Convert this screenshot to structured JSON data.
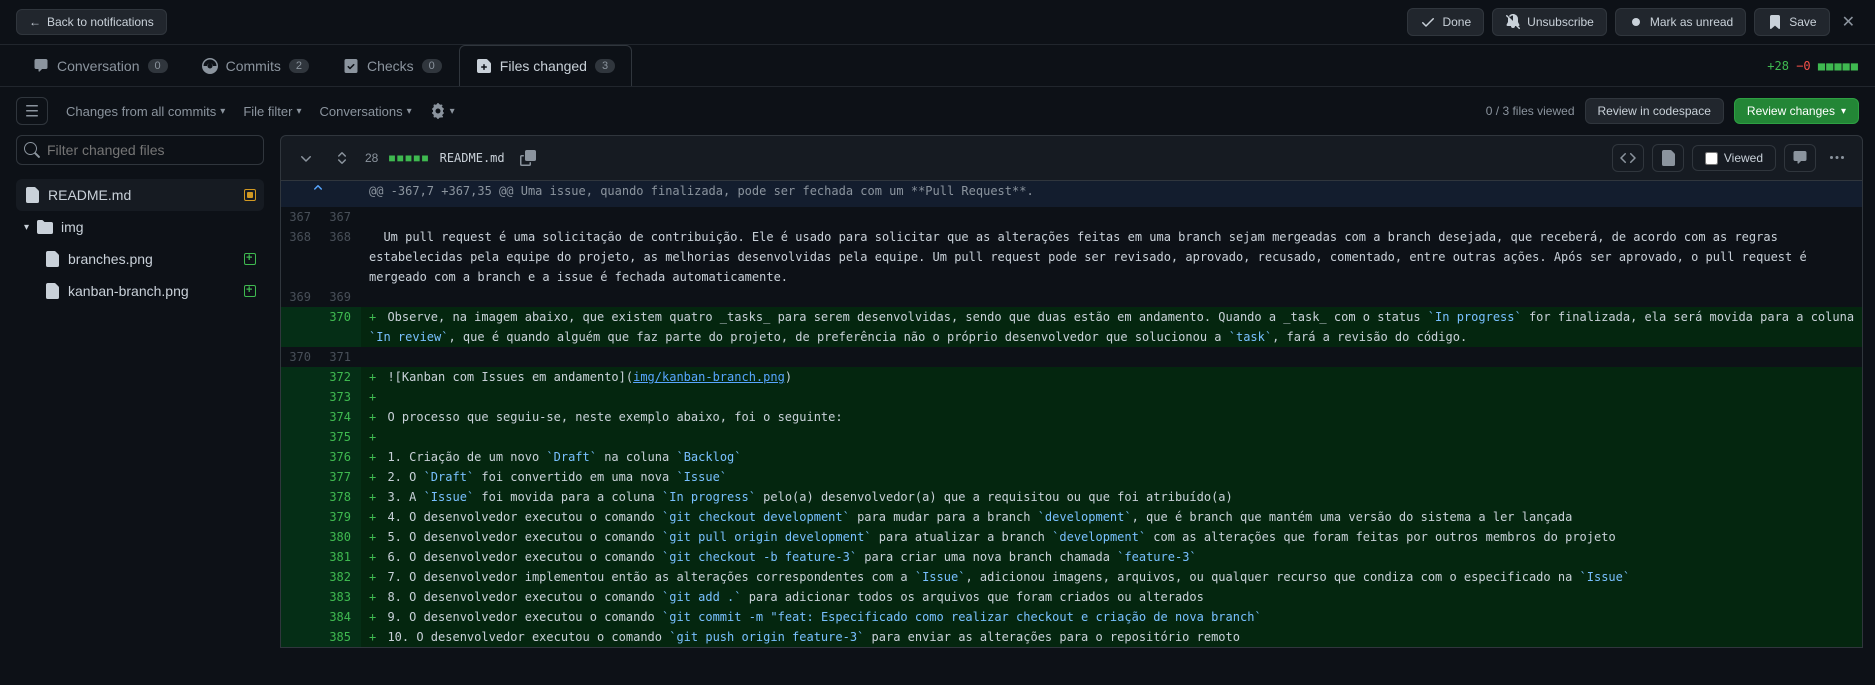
{
  "topbar": {
    "back": "Back to notifications",
    "done": "Done",
    "unsubscribe": "Unsubscribe",
    "mark_unread": "Mark as unread",
    "save": "Save"
  },
  "tabs": {
    "conversation": {
      "label": "Conversation",
      "count": "0"
    },
    "commits": {
      "label": "Commits",
      "count": "2"
    },
    "checks": {
      "label": "Checks",
      "count": "0"
    },
    "files": {
      "label": "Files changed",
      "count": "3"
    }
  },
  "diffstat": {
    "additions": "+28",
    "deletions": "−0",
    "blocks": "■■■■■"
  },
  "toolbar": {
    "changes_from": "Changes from all commits",
    "file_filter": "File filter",
    "conversations": "Conversations",
    "viewed": "0 / 3 files viewed",
    "review_codespace": "Review in codespace",
    "review_changes": "Review changes"
  },
  "sidebar": {
    "filter_placeholder": "Filter changed files",
    "files": {
      "readme": "README.md",
      "img_dir": "img",
      "branches": "branches.png",
      "kanban": "kanban-branch.png"
    }
  },
  "file": {
    "name": "README.md",
    "changes": "28",
    "viewed_label": "Viewed"
  },
  "diff": {
    "hunk": "@@ -367,7 +367,35 @@ Uma issue, quando finalizada, pode ser fechada com um **Pull Request**.",
    "rows": [
      {
        "old": "367",
        "new": "367",
        "type": "ctx",
        "content": ""
      },
      {
        "old": "368",
        "new": "368",
        "type": "ctx",
        "content": "Um pull request é uma solicitação de contribuição. Ele é usado para solicitar que as alterações feitas em uma branch sejam mergeadas com a branch desejada, que receberá, de acordo com as regras estabelecidas pela equipe do projeto, as melhorias desenvolvidas pela equipe. Um pull request pode ser revisado, aprovado, recusado, comentado, entre outras ações. Após ser aprovado, o pull request é mergeado com a branch e a issue é fechada automaticamente."
      },
      {
        "old": "369",
        "new": "369",
        "type": "ctx",
        "content": ""
      },
      {
        "old": "",
        "new": "370",
        "type": "add",
        "segments": [
          {
            "t": "Observe, na imagem abaixo, que existem quatro _tasks_ para serem desenvolvidas, sendo que duas estão em andamento. Quando a _task_ com o status "
          },
          {
            "c": "`In progress`"
          },
          {
            "t": " for finalizada, ela será movida para a coluna "
          },
          {
            "c": "`In review`"
          },
          {
            "t": ", que é quando alguém que faz parte do projeto, de preferência não o próprio desenvolvedor que solucionou a "
          },
          {
            "c": "`task`"
          },
          {
            "t": ", fará a revisão do código."
          }
        ]
      },
      {
        "old": "370",
        "new": "371",
        "type": "ctx",
        "content": ""
      },
      {
        "old": "",
        "new": "372",
        "type": "add",
        "segments": [
          {
            "t": "![Kanban com Issues em andamento]("
          },
          {
            "l": "img/kanban-branch.png"
          },
          {
            "t": ")"
          }
        ]
      },
      {
        "old": "",
        "new": "373",
        "type": "add",
        "segments": []
      },
      {
        "old": "",
        "new": "374",
        "type": "add",
        "segments": [
          {
            "t": "O processo que seguiu-se, neste exemplo abaixo, foi o seguinte:"
          }
        ]
      },
      {
        "old": "",
        "new": "375",
        "type": "add",
        "segments": []
      },
      {
        "old": "",
        "new": "376",
        "type": "add",
        "segments": [
          {
            "t": "1. Criação de um novo "
          },
          {
            "c": "`Draft`"
          },
          {
            "t": " na coluna "
          },
          {
            "c": "`Backlog`"
          }
        ]
      },
      {
        "old": "",
        "new": "377",
        "type": "add",
        "segments": [
          {
            "t": "2. O "
          },
          {
            "c": "`Draft`"
          },
          {
            "t": " foi convertido em uma nova "
          },
          {
            "c": "`Issue`"
          }
        ]
      },
      {
        "old": "",
        "new": "378",
        "type": "add",
        "segments": [
          {
            "t": "3. A "
          },
          {
            "c": "`Issue`"
          },
          {
            "t": " foi movida para a coluna "
          },
          {
            "c": "`In progress`"
          },
          {
            "t": " pelo(a) desenvolvedor(a) que a requisitou ou que foi atribuído(a)"
          }
        ]
      },
      {
        "old": "",
        "new": "379",
        "type": "add",
        "segments": [
          {
            "t": "4. O desenvolvedor executou o comando "
          },
          {
            "c": "`git checkout development`"
          },
          {
            "t": " para mudar para a branch "
          },
          {
            "c": "`development`"
          },
          {
            "t": ", que é branch que mantém uma versão do sistema a ler lançada"
          }
        ]
      },
      {
        "old": "",
        "new": "380",
        "type": "add",
        "segments": [
          {
            "t": "5. O desenvolvedor executou o comando "
          },
          {
            "c": "`git pull origin development`"
          },
          {
            "t": " para atualizar a branch "
          },
          {
            "c": "`development`"
          },
          {
            "t": " com as alterações que foram feitas por outros membros do projeto"
          }
        ]
      },
      {
        "old": "",
        "new": "381",
        "type": "add",
        "segments": [
          {
            "t": "6. O desenvolvedor executou o comando "
          },
          {
            "c": "`git checkout -b feature-3`"
          },
          {
            "t": " para criar uma nova branch chamada "
          },
          {
            "c": "`feature-3`"
          }
        ]
      },
      {
        "old": "",
        "new": "382",
        "type": "add",
        "segments": [
          {
            "t": "7. O desenvolvedor implementou então as alterações correspondentes com a "
          },
          {
            "c": "`Issue`"
          },
          {
            "t": ", adicionou imagens, arquivos, ou qualquer recurso que condiza com o especificado na "
          },
          {
            "c": "`Issue`"
          }
        ]
      },
      {
        "old": "",
        "new": "383",
        "type": "add",
        "segments": [
          {
            "t": "8. O desenvolvedor executou o comando "
          },
          {
            "c": "`git add .`"
          },
          {
            "t": " para adicionar todos os arquivos que foram criados ou alterados"
          }
        ]
      },
      {
        "old": "",
        "new": "384",
        "type": "add",
        "segments": [
          {
            "t": "9. O desenvolvedor executou o comando "
          },
          {
            "c": "`git commit -m \"feat: Especificado como realizar checkout e criação de nova branch`"
          }
        ]
      },
      {
        "old": "",
        "new": "385",
        "type": "add",
        "segments": [
          {
            "t": "10. O desenvolvedor executou o comando "
          },
          {
            "c": "`git push origin feature-3`"
          },
          {
            "t": " para enviar as alterações para o repositório remoto"
          }
        ]
      }
    ]
  }
}
